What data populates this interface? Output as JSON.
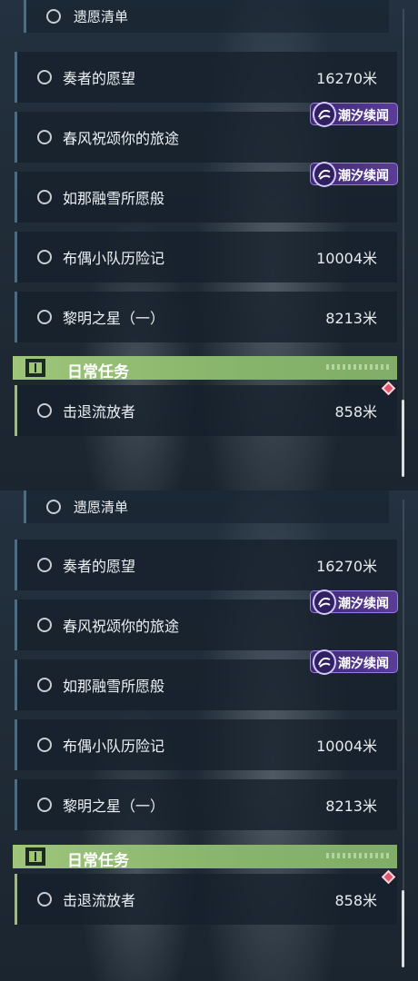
{
  "quest_list": {
    "top_item": "遗愿清单",
    "items": [
      {
        "label": "奏者的愿望",
        "distance": "16270米"
      },
      {
        "label": "春风祝颂你的旅途",
        "distance": ""
      },
      {
        "label": "如那融雪所愿般",
        "distance": ""
      },
      {
        "label": "布偶小队历险记",
        "distance": "10004米"
      },
      {
        "label": "黎明之星（一）",
        "distance": "8213米"
      }
    ],
    "tag_label": "潮汐续闻",
    "section_title": "日常任务",
    "daily_item": {
      "label": "击退流放者",
      "distance": "858米"
    }
  },
  "colors": {
    "accent_green": "#9ec57a",
    "tag_purple": "#5a3d98",
    "marker_red": "#e0566e"
  },
  "icons": {
    "bullet": "circle-outline-icon",
    "tag": "tide-sequel-icon",
    "section": "exclamation-box-icon",
    "marker": "diamond-marker-icon"
  }
}
